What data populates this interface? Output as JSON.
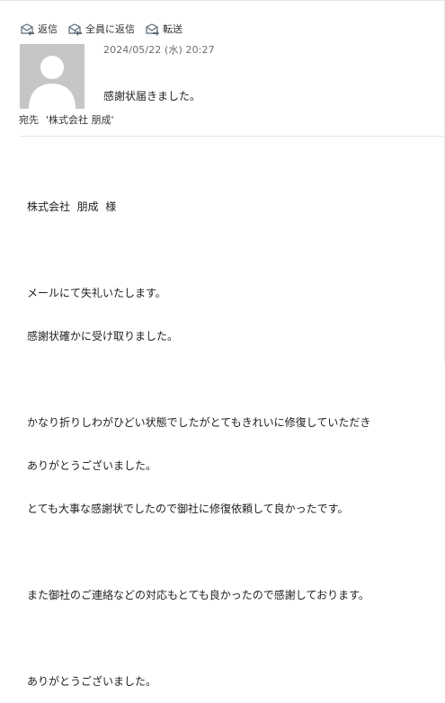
{
  "toolbar": {
    "reply": "返信",
    "reply_all": "全員に返信",
    "forward": "転送",
    "icon_reply": "reply-icon",
    "icon_reply_all": "reply-all-icon",
    "icon_forward": "forward-icon"
  },
  "message": {
    "datetime": "2024/05/22 (水) 20:27",
    "subject": "感謝状届きました。",
    "to_label": "宛先",
    "to_value": "'株式会社  朋成'",
    "body_lines": [
      "株式会社  朋成  様",
      "",
      "メールにて失礼いたします。",
      "感謝状確かに受け取りました。",
      "",
      "かなり折りしわがひどい状態でしたがとてもきれいに修復していただき",
      "ありがとうございました。",
      "とても大事な感謝状でしたので御社に修復依頼して良かったです。",
      "",
      "また御社のご連絡などの対応もとても良かったので感謝しております。",
      "",
      "ありがとうございました。"
    ]
  },
  "colors": {
    "avatar_bg": "#c6c6c6",
    "icon": "#5a6a7a"
  }
}
